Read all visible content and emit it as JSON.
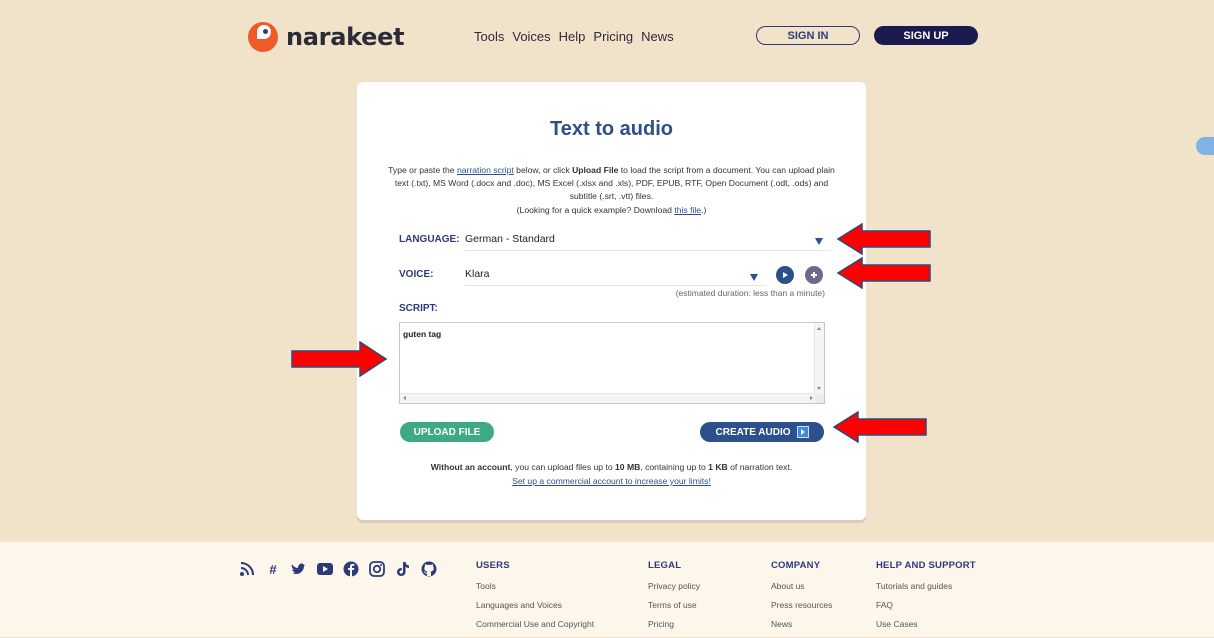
{
  "header": {
    "logo_text": "narakeet",
    "nav": [
      "Tools",
      "Voices",
      "Help",
      "Pricing",
      "News"
    ],
    "sign_in": "SIGN IN",
    "sign_up": "SIGN UP"
  },
  "card": {
    "title": "Text to audio",
    "intro": {
      "p1": "Type or paste the ",
      "link1": "narration script",
      "p2": " below, or click ",
      "bold1": "Upload File",
      "p3": " to load the script from a document. You can upload plain text (.txt), MS Word (.docx and .doc), MS Excel (.xlsx and .xls), PDF, EPUB, RTF, Open Document (.odt, .ods) and subtitle (.srt, .vtt) files.",
      "p4": "(Looking for a quick example? Download ",
      "link2": "this file",
      "p5": ".)"
    },
    "language": {
      "label": "LANGUAGE:",
      "value": "German - Standard"
    },
    "voice": {
      "label": "VOICE:",
      "value": "Klara"
    },
    "script": {
      "label": "SCRIPT:",
      "duration": "(estimated duration: less than a minute)",
      "value": "guten tag"
    },
    "upload_button": "UPLOAD FILE",
    "create_button": "CREATE AUDIO",
    "limits": {
      "bold": "Without an account",
      "text": ", you can upload files up to ",
      "size": "10 MB",
      "text2": ", containing up to ",
      "kb": "1 KB",
      "text3": " of narration text.",
      "link": "Set up a commercial account to increase your limits!"
    }
  },
  "footer": {
    "social_icons": [
      "rss-icon",
      "slack-icon",
      "twitter-icon",
      "youtube-icon",
      "facebook-icon",
      "instagram-icon",
      "tiktok-icon",
      "github-icon"
    ],
    "users": {
      "heading": "USERS",
      "items": [
        "Tools",
        "Languages and Voices",
        "Commercial Use and Copyright"
      ]
    },
    "legal": {
      "heading": "LEGAL",
      "items": [
        "Privacy policy",
        "Terms of use",
        "Pricing"
      ]
    },
    "company": {
      "heading": "COMPANY",
      "items": [
        "About us",
        "Press resources",
        "News"
      ]
    },
    "help": {
      "heading": "HELP AND SUPPORT",
      "items": [
        "Tutorials and guides",
        "FAQ",
        "Use Cases"
      ]
    }
  },
  "colors": {
    "background": "#f1e3c9",
    "accent_blue": "#2d4f8b",
    "green": "#3daa82",
    "logo_orange": "#f05a28",
    "annotation_red": "#ff0000"
  }
}
